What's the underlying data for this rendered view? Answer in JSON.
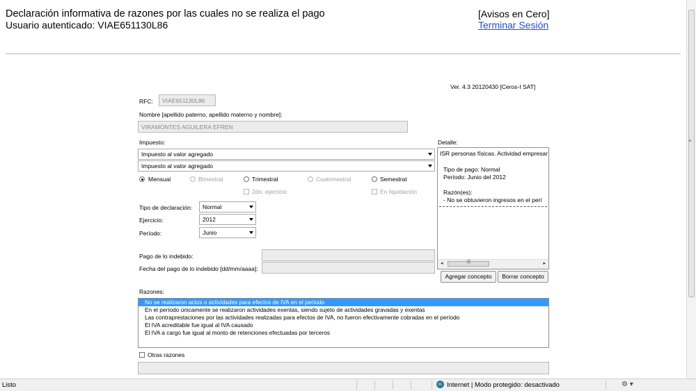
{
  "header": {
    "title": "Declaración informativa de razones por las cuales no se realiza el pago",
    "user_line": "Usuario autenticado: VIAE651130L86",
    "avisos": "[Avisos en Cero]",
    "logout": "Terminar Sesión"
  },
  "version_line": "Ver. 4.3  20120430  [Ceros-I SAT]",
  "form": {
    "rfc_label": "RFC:",
    "rfc_value": "VIAE651130L86",
    "nombre_label": "Nombre [apellido paterno, apellido materno y nombre]:",
    "nombre_value": "VIRAMONTES AGUILERA EFREN",
    "impuesto_label": "Impuesto:",
    "impuesto_select_1": "Impuesto al valor agregado",
    "impuesto_select_2": "Impuesto al valor agregado",
    "periodicidad": {
      "mensual": "Mensual",
      "bimestral": "Bimestral",
      "trimestral": "Trimestral",
      "cuatrimestral": "Cuatrimestral",
      "semestral": "Semestral"
    },
    "segundo_ejercicio": "2do. ejercicio",
    "en_liquidacion": "En liquidación",
    "tipo_declaracion_label": "Tipo de declaración:",
    "tipo_declaracion_value": "Normal",
    "ejercicio_label": "Ejercicio:",
    "ejercicio_value": "2012",
    "periodo_label": "Período:",
    "periodo_value": "Junio",
    "pago_indebido_label": "Pago de lo indebido:",
    "fecha_pago_indebido_label": "Fecha del pago de lo indebido [dd/mm/aaaa]:",
    "razones_label": "Razones:",
    "razones_options": [
      "No se realizaron actos o actividades para efectos de IVA en el período",
      "En el período únicamente se realizaron actividades exentas, siendo sujeto de actividades gravadas y exentas",
      "Las contraprestaciones por las actividades realizadas para efectos de IVA, no fueron efectivamente cobradas en el período",
      "El IVA acreditable fue igual al IVA causado",
      "El IVA a cargo fue igual al monto de retenciones efectuadas por terceros"
    ],
    "otras_razones_label": "Otras razones"
  },
  "detalle": {
    "label": "Detalle:",
    "line_1": "ISR personas físicas. Actividad empresar",
    "line_2": "Tipo de pago: Normal",
    "line_3": "Período: Junio del 2012",
    "line_4": "Razón(es):",
    "line_5": "-     No se obtuvieron ingresos en el perí",
    "agregar_button": "Agregar concepto",
    "borrar_button": "Borrar concepto"
  },
  "statusbar": {
    "status": "Listo",
    "zone": "Internet | Modo protegido: desactivado"
  },
  "colors": {
    "link": "#1f50c4",
    "selection": "#3399ff",
    "disabled_field": "#ececec"
  }
}
